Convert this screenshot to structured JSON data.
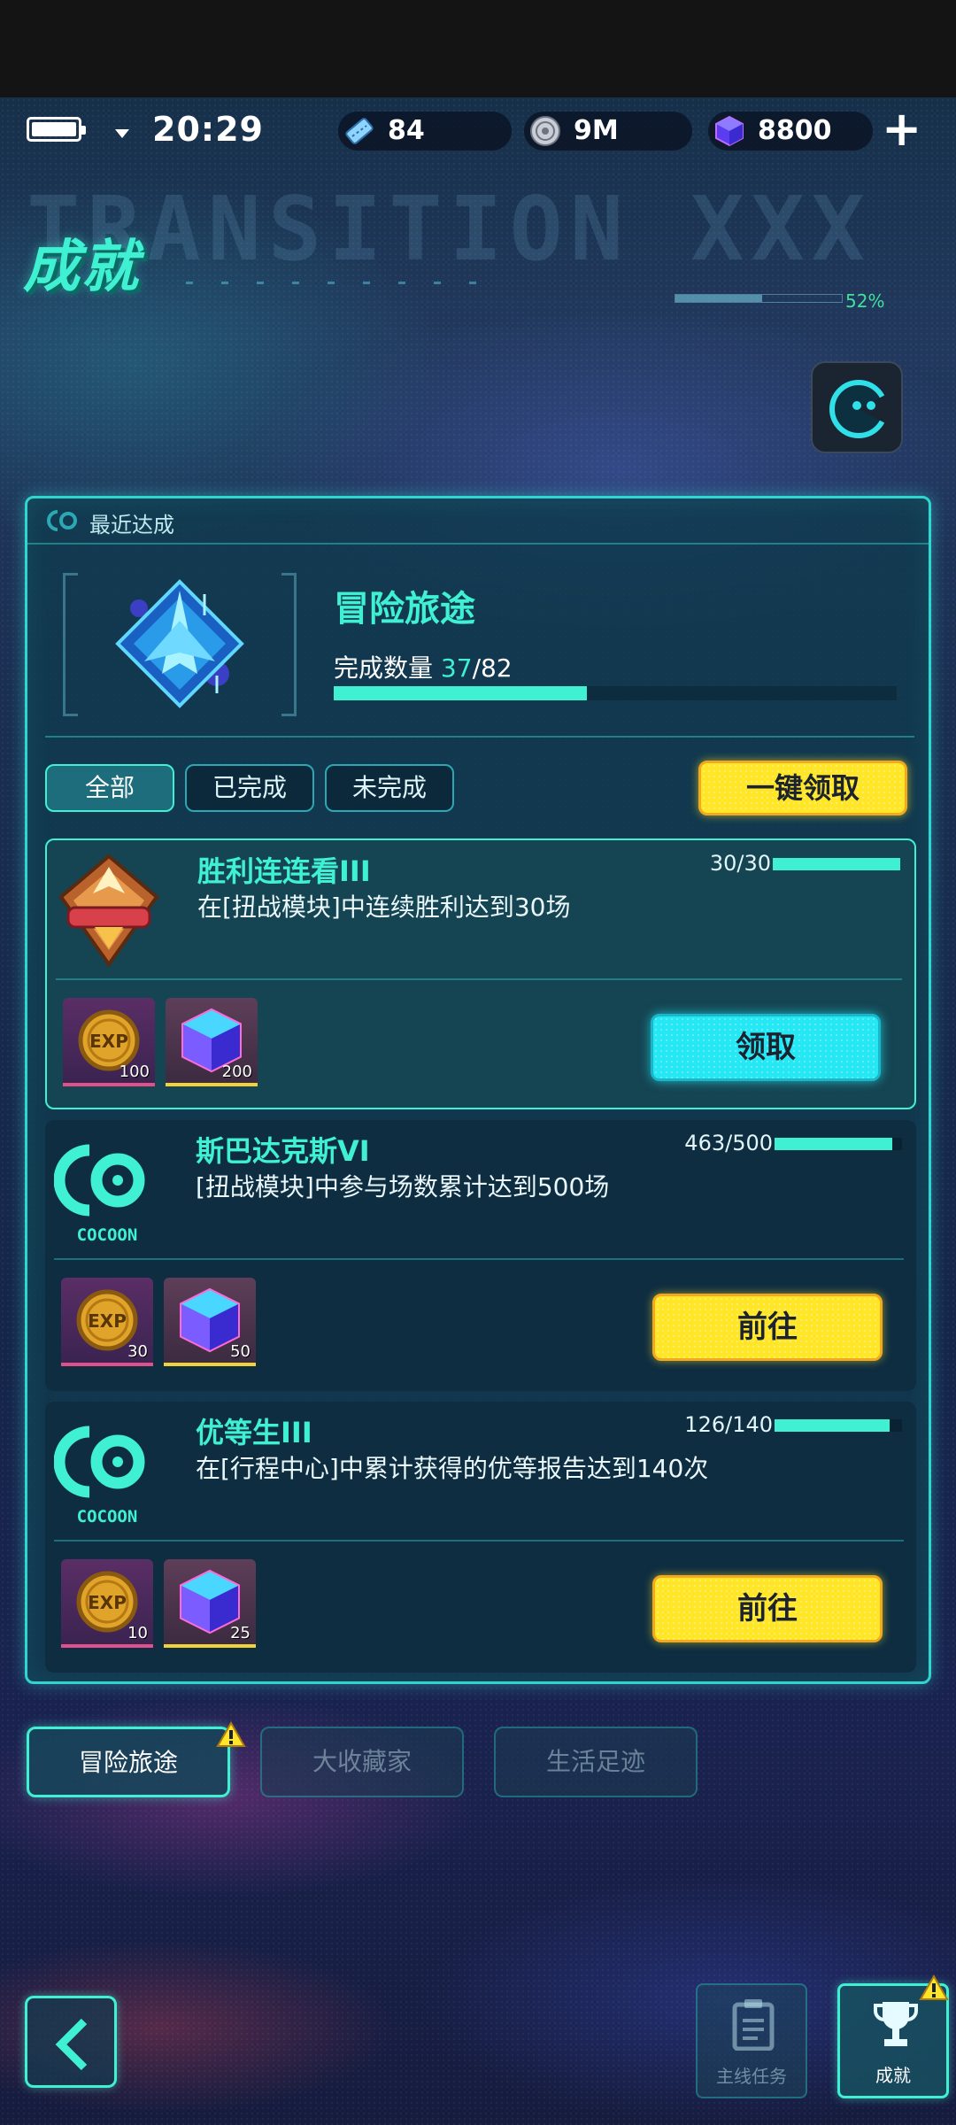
{
  "status_bar": {
    "time": "20:29"
  },
  "resources": {
    "tickets": "84",
    "coins": "9M",
    "gems": "8800",
    "add_label": "+"
  },
  "header": {
    "title": "成就",
    "ghost_text": "TRANSITION XXX",
    "ghost_pct": "52%"
  },
  "recent": {
    "label": "最近达成",
    "title": "冒险旅途",
    "count_label": "完成数量",
    "count_done": "37",
    "count_total": "/82",
    "progress": 0.45
  },
  "filters": {
    "all": "全部",
    "completed": "已完成",
    "incomplete": "未完成",
    "claim_all": "一键领取"
  },
  "achievements": [
    {
      "name": "胜利连连看III",
      "desc": "在[扭战模块]中连续胜利达到30场",
      "progress_text": "30/30",
      "progress": 1.0,
      "rewards": [
        {
          "type": "exp",
          "amount": "100"
        },
        {
          "type": "gem",
          "amount": "200"
        }
      ],
      "action": "领取"
    },
    {
      "name": "斯巴达克斯VI",
      "desc": "[扭战模块]中参与场数累计达到500场",
      "progress_text": "463/500",
      "progress": 0.926,
      "rewards": [
        {
          "type": "exp",
          "amount": "30"
        },
        {
          "type": "gem",
          "amount": "50"
        }
      ],
      "action": "前往",
      "logo_text": "COCOON"
    },
    {
      "name": "优等生III",
      "desc": "在[行程中心]中累计获得的优等报告达到140次",
      "progress_text": "126/140",
      "progress": 0.9,
      "rewards": [
        {
          "type": "exp",
          "amount": "10"
        },
        {
          "type": "gem",
          "amount": "25"
        }
      ],
      "action": "前往",
      "logo_text": "COCOON"
    }
  ],
  "categories": {
    "adventure": "冒险旅途",
    "collector": "大收藏家",
    "life": "生活足迹"
  },
  "bottom_nav": {
    "main_task": "主线任务",
    "achievement": "成就"
  },
  "colors": {
    "accent": "#3ff0d2",
    "claim": "#26e8f5",
    "go": "#ffe629",
    "panel_border": "#2fd6d0"
  }
}
